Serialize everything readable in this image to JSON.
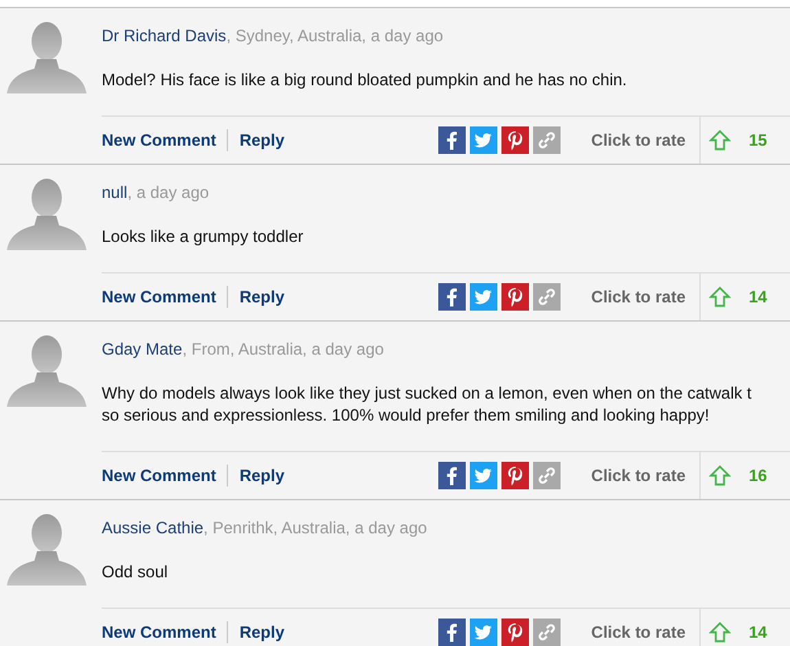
{
  "comments": [
    {
      "author": "Dr Richard Davis",
      "meta": ", Sydney, Australia, a day ago",
      "lines": [
        "Model? His face is like a big round bloated pumpkin and he has no chin."
      ],
      "new_comment": "New Comment",
      "reply": "Reply",
      "rate_label": "Click to rate",
      "votes": "15"
    },
    {
      "author": "null",
      "meta": ", a day ago",
      "lines": [
        "Looks like a grumpy toddler"
      ],
      "new_comment": "New Comment",
      "reply": "Reply",
      "rate_label": "Click to rate",
      "votes": "14"
    },
    {
      "author": "Gday Mate",
      "meta": ", From, Australia, a day ago",
      "lines": [
        "Why do models always look like they just sucked on a lemon, even when on the catwalk t",
        "so serious and expressionless. 100% would prefer them smiling and looking happy!"
      ],
      "new_comment": "New Comment",
      "reply": "Reply",
      "rate_label": "Click to rate",
      "votes": "16"
    },
    {
      "author": "Aussie Cathie",
      "meta": ", Penrithk, Australia, a day ago",
      "lines": [
        "Odd soul"
      ],
      "new_comment": "New Comment",
      "reply": "Reply",
      "rate_label": "Click to rate",
      "votes": "14"
    }
  ]
}
